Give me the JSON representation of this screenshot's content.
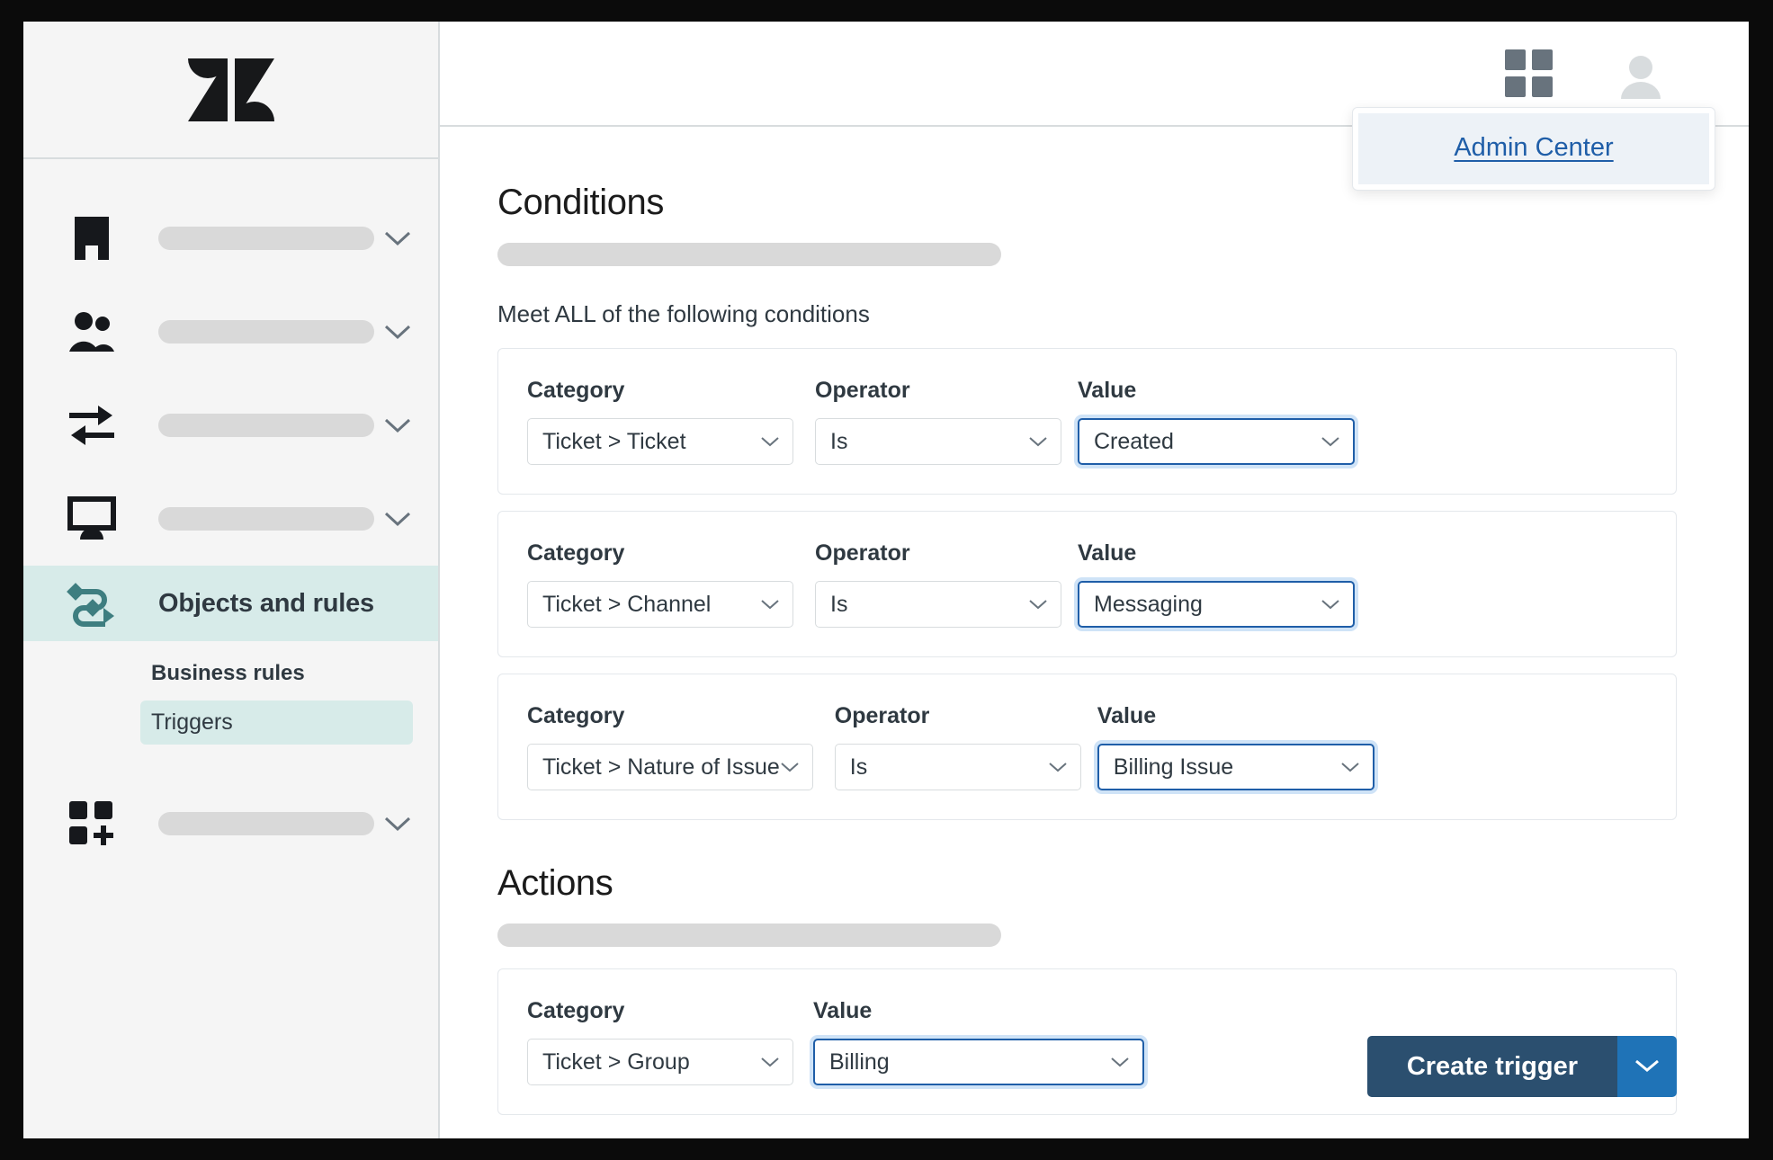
{
  "app": {
    "logo_icon": "zendesk-logo",
    "brand_teal": "#3e7e80",
    "highlight_teal": "#d7ebe9",
    "accent_blue": "#1f5ea8",
    "primary_button_color": "#2b4f6f",
    "split_button_color": "#1f73b7"
  },
  "topbar": {
    "apps_icon": "apps-grid-icon",
    "avatar_icon": "user-avatar-icon",
    "dropdown": {
      "link_label": "Admin Center"
    }
  },
  "sidebar": {
    "items": [
      {
        "icon": "building-icon",
        "label": "",
        "chevron": "chevron-down-icon"
      },
      {
        "icon": "people-icon",
        "label": "",
        "chevron": "chevron-down-icon"
      },
      {
        "icon": "transfer-arrows-icon",
        "label": "",
        "chevron": "chevron-down-icon"
      },
      {
        "icon": "monitor-icon",
        "label": "",
        "chevron": "chevron-down-icon"
      },
      {
        "icon": "objects-rules-icon",
        "label": "Objects and rules",
        "chevron": ""
      },
      {
        "icon": "apps-plus-icon",
        "label": "",
        "chevron": "chevron-down-icon"
      }
    ],
    "sub_section": {
      "heading": "Business rules",
      "items": [
        {
          "label": "Triggers",
          "selected": true
        }
      ]
    }
  },
  "main": {
    "conditions": {
      "title": "Conditions",
      "subtitle": "Meet ALL of the following conditions",
      "labels": {
        "category": "Category",
        "operator": "Operator",
        "value": "Value"
      },
      "rows": [
        {
          "category": "Ticket > Ticket",
          "operator": "Is",
          "value": "Created",
          "value_focused": true
        },
        {
          "category": "Ticket > Channel",
          "operator": "Is",
          "value": "Messaging",
          "value_focused": true
        },
        {
          "category": "Ticket > Nature of Issue",
          "operator": "Is",
          "value": "Billing Issue",
          "value_focused": true
        }
      ]
    },
    "actions": {
      "title": "Actions",
      "labels": {
        "category": "Category",
        "value": "Value"
      },
      "rows": [
        {
          "category": "Ticket > Group",
          "value": "Billing",
          "value_focused": true
        }
      ]
    },
    "footer": {
      "create_button_label": "Create trigger",
      "split_icon": "chevron-down-icon"
    }
  }
}
